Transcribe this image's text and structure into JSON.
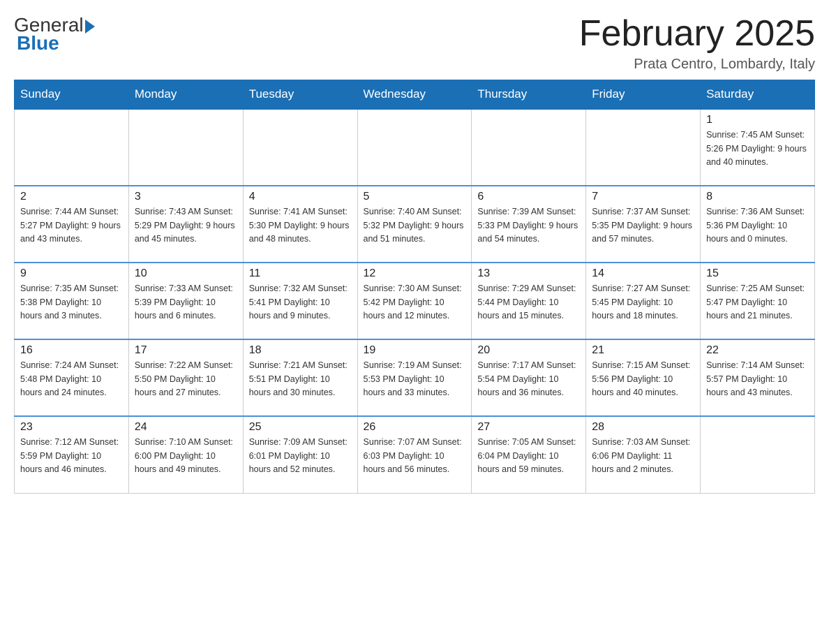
{
  "header": {
    "logo": {
      "general": "General",
      "blue": "Blue"
    },
    "title": "February 2025",
    "location": "Prata Centro, Lombardy, Italy"
  },
  "days_of_week": [
    "Sunday",
    "Monday",
    "Tuesday",
    "Wednesday",
    "Thursday",
    "Friday",
    "Saturday"
  ],
  "weeks": [
    [
      {
        "day": "",
        "info": ""
      },
      {
        "day": "",
        "info": ""
      },
      {
        "day": "",
        "info": ""
      },
      {
        "day": "",
        "info": ""
      },
      {
        "day": "",
        "info": ""
      },
      {
        "day": "",
        "info": ""
      },
      {
        "day": "1",
        "info": "Sunrise: 7:45 AM\nSunset: 5:26 PM\nDaylight: 9 hours and 40 minutes."
      }
    ],
    [
      {
        "day": "2",
        "info": "Sunrise: 7:44 AM\nSunset: 5:27 PM\nDaylight: 9 hours and 43 minutes."
      },
      {
        "day": "3",
        "info": "Sunrise: 7:43 AM\nSunset: 5:29 PM\nDaylight: 9 hours and 45 minutes."
      },
      {
        "day": "4",
        "info": "Sunrise: 7:41 AM\nSunset: 5:30 PM\nDaylight: 9 hours and 48 minutes."
      },
      {
        "day": "5",
        "info": "Sunrise: 7:40 AM\nSunset: 5:32 PM\nDaylight: 9 hours and 51 minutes."
      },
      {
        "day": "6",
        "info": "Sunrise: 7:39 AM\nSunset: 5:33 PM\nDaylight: 9 hours and 54 minutes."
      },
      {
        "day": "7",
        "info": "Sunrise: 7:37 AM\nSunset: 5:35 PM\nDaylight: 9 hours and 57 minutes."
      },
      {
        "day": "8",
        "info": "Sunrise: 7:36 AM\nSunset: 5:36 PM\nDaylight: 10 hours and 0 minutes."
      }
    ],
    [
      {
        "day": "9",
        "info": "Sunrise: 7:35 AM\nSunset: 5:38 PM\nDaylight: 10 hours and 3 minutes."
      },
      {
        "day": "10",
        "info": "Sunrise: 7:33 AM\nSunset: 5:39 PM\nDaylight: 10 hours and 6 minutes."
      },
      {
        "day": "11",
        "info": "Sunrise: 7:32 AM\nSunset: 5:41 PM\nDaylight: 10 hours and 9 minutes."
      },
      {
        "day": "12",
        "info": "Sunrise: 7:30 AM\nSunset: 5:42 PM\nDaylight: 10 hours and 12 minutes."
      },
      {
        "day": "13",
        "info": "Sunrise: 7:29 AM\nSunset: 5:44 PM\nDaylight: 10 hours and 15 minutes."
      },
      {
        "day": "14",
        "info": "Sunrise: 7:27 AM\nSunset: 5:45 PM\nDaylight: 10 hours and 18 minutes."
      },
      {
        "day": "15",
        "info": "Sunrise: 7:25 AM\nSunset: 5:47 PM\nDaylight: 10 hours and 21 minutes."
      }
    ],
    [
      {
        "day": "16",
        "info": "Sunrise: 7:24 AM\nSunset: 5:48 PM\nDaylight: 10 hours and 24 minutes."
      },
      {
        "day": "17",
        "info": "Sunrise: 7:22 AM\nSunset: 5:50 PM\nDaylight: 10 hours and 27 minutes."
      },
      {
        "day": "18",
        "info": "Sunrise: 7:21 AM\nSunset: 5:51 PM\nDaylight: 10 hours and 30 minutes."
      },
      {
        "day": "19",
        "info": "Sunrise: 7:19 AM\nSunset: 5:53 PM\nDaylight: 10 hours and 33 minutes."
      },
      {
        "day": "20",
        "info": "Sunrise: 7:17 AM\nSunset: 5:54 PM\nDaylight: 10 hours and 36 minutes."
      },
      {
        "day": "21",
        "info": "Sunrise: 7:15 AM\nSunset: 5:56 PM\nDaylight: 10 hours and 40 minutes."
      },
      {
        "day": "22",
        "info": "Sunrise: 7:14 AM\nSunset: 5:57 PM\nDaylight: 10 hours and 43 minutes."
      }
    ],
    [
      {
        "day": "23",
        "info": "Sunrise: 7:12 AM\nSunset: 5:59 PM\nDaylight: 10 hours and 46 minutes."
      },
      {
        "day": "24",
        "info": "Sunrise: 7:10 AM\nSunset: 6:00 PM\nDaylight: 10 hours and 49 minutes."
      },
      {
        "day": "25",
        "info": "Sunrise: 7:09 AM\nSunset: 6:01 PM\nDaylight: 10 hours and 52 minutes."
      },
      {
        "day": "26",
        "info": "Sunrise: 7:07 AM\nSunset: 6:03 PM\nDaylight: 10 hours and 56 minutes."
      },
      {
        "day": "27",
        "info": "Sunrise: 7:05 AM\nSunset: 6:04 PM\nDaylight: 10 hours and 59 minutes."
      },
      {
        "day": "28",
        "info": "Sunrise: 7:03 AM\nSunset: 6:06 PM\nDaylight: 11 hours and 2 minutes."
      },
      {
        "day": "",
        "info": ""
      }
    ]
  ]
}
